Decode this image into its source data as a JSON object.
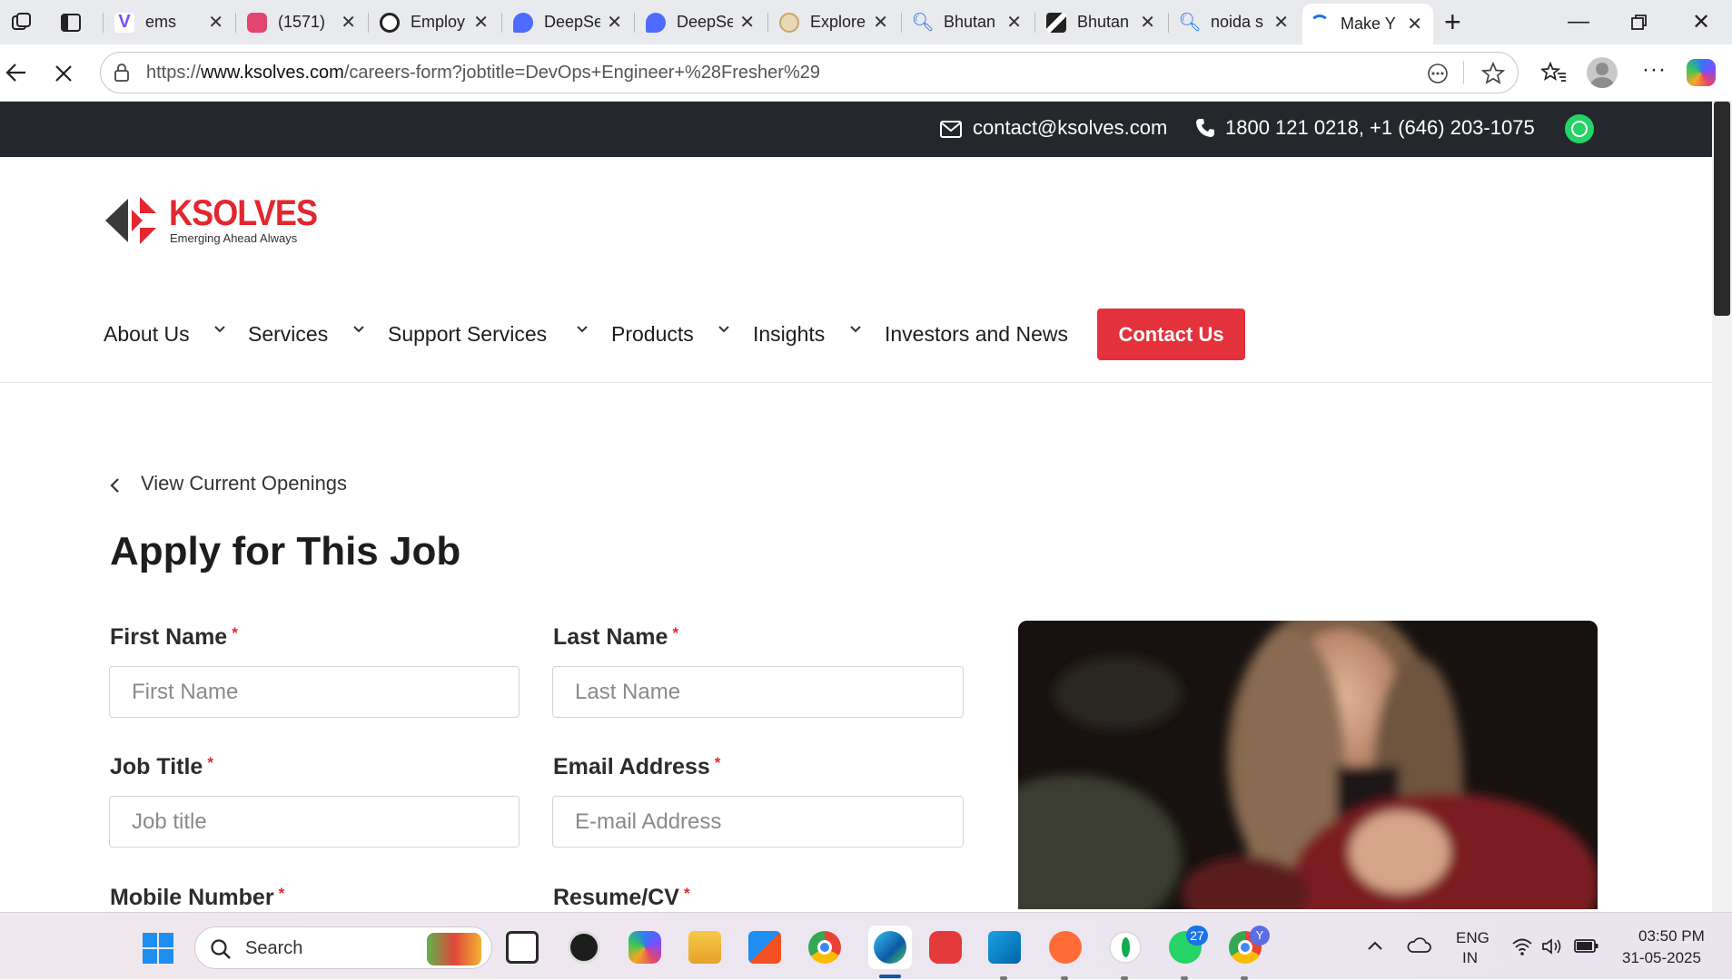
{
  "browser": {
    "tabs": [
      {
        "title": "ems",
        "color": "#7b4dff"
      },
      {
        "title": "(1571)",
        "color": "#e2456f"
      },
      {
        "title": "Employ",
        "color": "#222222"
      },
      {
        "title": "DeepSe",
        "color": "#4d6bfe"
      },
      {
        "title": "DeepSe",
        "color": "#4d6bfe"
      },
      {
        "title": "Explore",
        "color": "#c9a46a"
      },
      {
        "title": "Bhutan",
        "color": "#1a73e8"
      },
      {
        "title": "Bhutan",
        "color": "#222222"
      },
      {
        "title": "noida s",
        "color": "#1a73e8"
      },
      {
        "title": "Make Y",
        "color": "#1a73e8"
      }
    ],
    "url_prefix": "https://",
    "url_domain": "www.ksolves.com",
    "url_path": "/careers-form?jobtitle=DevOps+Engineer+%28Fresher%29"
  },
  "topbar": {
    "email": "contact@ksolves.com",
    "phone": "1800 121 0218,  +1 (646) 203-1075"
  },
  "logo": {
    "name": "KSOLVES",
    "tagline": "Emerging Ahead Always"
  },
  "nav": {
    "about": "About Us",
    "services": "Services",
    "support": "Support Services",
    "products": "Products",
    "insights": "Insights",
    "investors": "Investors and News",
    "contact": "Contact Us"
  },
  "form": {
    "back_link": "View Current Openings",
    "title": "Apply for This Job",
    "first_name": {
      "label": "First Name",
      "placeholder": "First Name"
    },
    "last_name": {
      "label": "Last Name",
      "placeholder": "Last Name"
    },
    "job_title": {
      "label": "Job Title",
      "placeholder": "Job title"
    },
    "email": {
      "label": "Email Address",
      "placeholder": "E-mail Address"
    },
    "mobile": {
      "label": "Mobile Number"
    },
    "resume": {
      "label": "Resume/CV"
    },
    "required_mark": "*"
  },
  "taskbar": {
    "search_label": "Search",
    "lang_top": "ENG",
    "lang_bottom": "IN",
    "time": "03:50 PM",
    "date": "31-05-2025",
    "whatsapp_badge": "27",
    "chrome_badge": "Y"
  },
  "colors": {
    "brand_red": "#e3262f",
    "topbar_bg": "#24272b"
  }
}
